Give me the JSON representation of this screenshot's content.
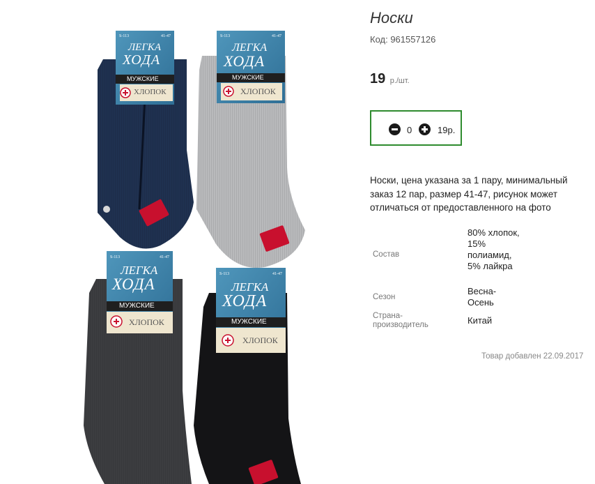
{
  "product": {
    "title": "Носки",
    "code_text": "Код: 961557126",
    "price_value": "19",
    "price_unit": "р./шт.",
    "quantity": "0",
    "sum_text": "19р.",
    "description": "Носки, цена указана за 1 пару, минимальный заказ 12 пар, размер 41-47, рисунок может отличаться от предоставленного на фото",
    "attributes": [
      {
        "label": "Состав",
        "value": "80% хлопок, 15% полиамид, 5% лайкра"
      },
      {
        "label": "Сезон",
        "value": "Весна-Осень"
      },
      {
        "label": "Страна-производитель",
        "value": "Китай"
      }
    ],
    "added_text": "Товар добавлен 22.09.2017"
  },
  "photo": {
    "labels": {
      "brand_top": "ЛЕГКА",
      "brand_bottom": "ХОДА",
      "gender": "МУЖСКИЕ",
      "material": "ХЛОПОК",
      "model": "S-113",
      "size": "41-47"
    },
    "sock_colors": {
      "navy": "#1f3150",
      "grey": "#b9babc",
      "charcoal": "#3c3d40",
      "black": "#141416"
    },
    "label_color": "#3f86ad"
  }
}
